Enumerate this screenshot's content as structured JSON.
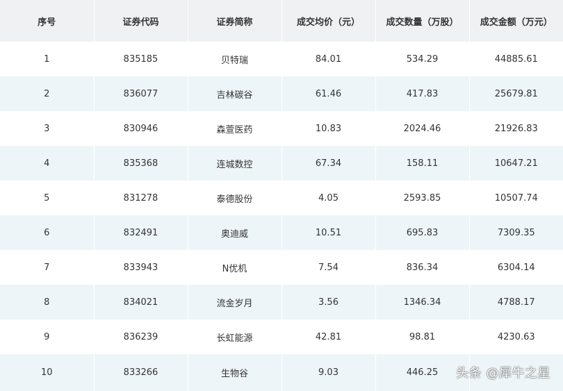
{
  "table": {
    "headers": [
      "序号",
      "证券代码",
      "证券简称",
      "成交均价（元）",
      "成交数量（万股）",
      "成交金额（万元）"
    ],
    "rows": [
      [
        "1",
        "835185",
        "贝特瑞",
        "84.01",
        "534.29",
        "44885.61"
      ],
      [
        "2",
        "836077",
        "吉林碳谷",
        "61.46",
        "417.83",
        "25679.81"
      ],
      [
        "3",
        "830946",
        "森萱医药",
        "10.83",
        "2024.46",
        "21926.83"
      ],
      [
        "4",
        "835368",
        "连城数控",
        "67.34",
        "158.11",
        "10647.21"
      ],
      [
        "5",
        "831278",
        "泰德股份",
        "4.05",
        "2593.85",
        "10507.74"
      ],
      [
        "6",
        "832491",
        "奥迪威",
        "10.51",
        "695.83",
        "7309.35"
      ],
      [
        "7",
        "833943",
        "N优机",
        "7.54",
        "836.34",
        "6304.14"
      ],
      [
        "8",
        "834021",
        "流金岁月",
        "3.56",
        "1346.34",
        "4788.17"
      ],
      [
        "9",
        "836239",
        "长虹能源",
        "42.81",
        "98.81",
        "4230.63"
      ],
      [
        "10",
        "833266",
        "生物谷",
        "9.03",
        "446.25",
        ""
      ]
    ]
  },
  "watermark": {
    "text": "头条 @犀牛之星"
  }
}
